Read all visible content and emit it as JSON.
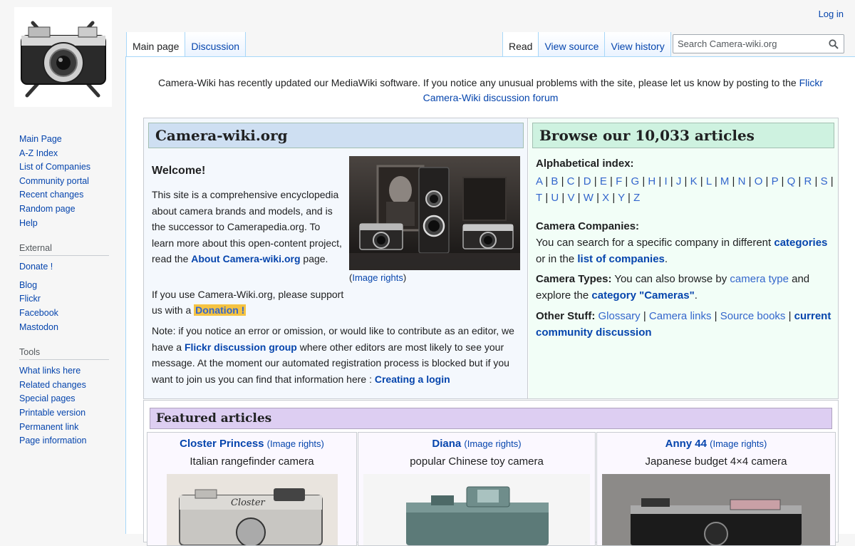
{
  "personal": {
    "login": "Log in"
  },
  "tabs": {
    "left": [
      {
        "label": "Main page"
      },
      {
        "label": "Discussion"
      }
    ],
    "right": [
      {
        "label": "Read"
      },
      {
        "label": "View source"
      },
      {
        "label": "View history"
      }
    ]
  },
  "search": {
    "placeholder": "Search Camera-wiki.org"
  },
  "sidebar": {
    "navigation": [
      {
        "label": "Main Page"
      },
      {
        "label": "A-Z Index"
      },
      {
        "label": "List of Companies"
      },
      {
        "label": "Community portal"
      },
      {
        "label": "Recent changes"
      },
      {
        "label": "Random page"
      },
      {
        "label": "Help"
      }
    ],
    "external": {
      "heading": "External",
      "items": [
        {
          "label": "Donate !"
        },
        {
          "label": "Blog"
        },
        {
          "label": "Flickr"
        },
        {
          "label": "Facebook"
        },
        {
          "label": "Mastodon"
        }
      ]
    },
    "tools": {
      "heading": "Tools",
      "items": [
        {
          "label": "What links here"
        },
        {
          "label": "Related changes"
        },
        {
          "label": "Special pages"
        },
        {
          "label": "Printable version"
        },
        {
          "label": "Permanent link"
        },
        {
          "label": "Page information"
        }
      ]
    }
  },
  "sitenotice": {
    "text": "Camera-Wiki has recently updated our MediaWiki software. If you notice any unusual problems with the site, please let us know by posting to the ",
    "link": "Flickr Camera-Wiki discussion forum"
  },
  "left_panel": {
    "title": "Camera-wiki.org",
    "welcome": "Welcome!",
    "intro": "This site is a comprehensive encyclopedia about camera brands and models, and is the successor to Camerapedia.org. To learn more about this open-content project, read the ",
    "about_link": "About Camera-wiki.org",
    "intro_end": " page.",
    "image_rights": "Image rights",
    "support": "If you use Camera-Wiki.org, please support us with a ",
    "donation": "Donation !",
    "note_1": "Note: if you notice an error or omission, or would like to contribute as an editor, we have a ",
    "flickr_link": "Flickr discussion group",
    "note_2": " where other editors are most likely to see your message. At the moment our automated registration process is blocked but if you want to join us you can find that information here : ",
    "login_link": "Creating a login"
  },
  "right_panel": {
    "title": "Browse our 10,033 articles",
    "alpha_title": "Alphabetical index:",
    "letters": [
      "A",
      "B",
      "C",
      "D",
      "E",
      "F",
      "G",
      "H",
      "I",
      "J",
      "K",
      "L",
      "M",
      "N",
      "O",
      "P",
      "Q",
      "R",
      "S",
      "T",
      "U",
      "V",
      "W",
      "X",
      "Y",
      "Z"
    ],
    "companies_label": "Camera Companies:",
    "companies_text_1": "You can search for a specific company in different ",
    "categories_link": "categories",
    "companies_text_2": " or in the ",
    "list_link": "list of companies",
    "companies_text_3": ".",
    "types_label": "Camera Types:",
    "types_text_1": " You can also browse by ",
    "camera_type_link": "camera type",
    "types_text_2": " and explore the ",
    "category_cameras_link": "category \"Cameras\"",
    "types_text_3": ".",
    "other_label": "Other Stuff:",
    "glossary": "Glossary",
    "camera_links": "Camera links",
    "source_books": "Source books",
    "sep": " | ",
    "current_discussion": "current community discussion"
  },
  "featured": {
    "title": "Featured articles",
    "articles": [
      {
        "name": "Closter Princess",
        "rights": "(Image rights)",
        "desc": "Italian rangefinder camera"
      },
      {
        "name": "Diana",
        "rights": "(Image rights)",
        "desc": "popular Chinese toy camera"
      },
      {
        "name": "Anny 44",
        "rights": "(Image rights)",
        "desc": "Japanese budget 4×4 camera"
      }
    ]
  },
  "colors": {
    "link": "#0645ad",
    "light_link": "#3366cc",
    "donation_bg": "#f5c342"
  }
}
